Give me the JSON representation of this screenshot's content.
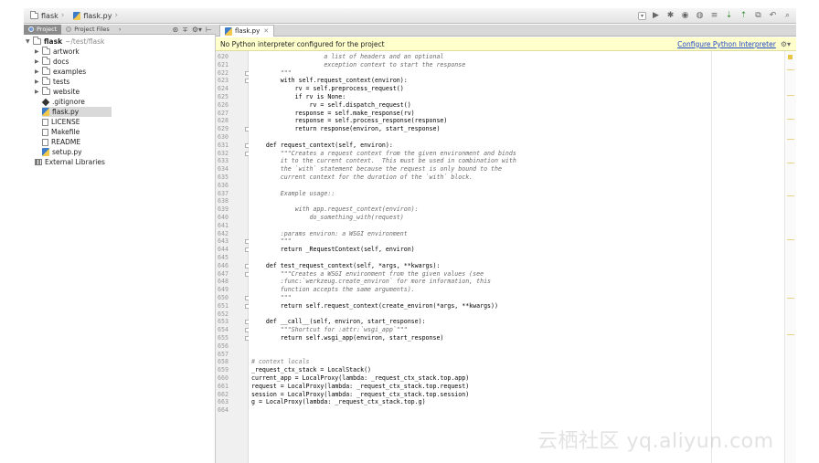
{
  "navbar": {
    "breadcrumbs": [
      {
        "label": "flask",
        "icon": "folder-icon"
      },
      {
        "label": "flask.py",
        "icon": "python-file-icon"
      }
    ],
    "tools": [
      "dropdown-icon",
      "run-icon",
      "debug-icon",
      "coverage-icon",
      "profile-icon",
      "build-icon",
      "vcs-update-icon",
      "vcs-commit-icon",
      "vcs-history-icon",
      "revert-icon",
      "search-icon"
    ]
  },
  "project_panel": {
    "tabs": [
      {
        "label": "Project",
        "active": true
      },
      {
        "label": "Project Files",
        "active": false
      }
    ],
    "root": {
      "label": "flask",
      "path": "~/test/flask"
    },
    "items": [
      {
        "label": "artwork",
        "type": "folder"
      },
      {
        "label": "docs",
        "type": "folder"
      },
      {
        "label": "examples",
        "type": "folder"
      },
      {
        "label": "tests",
        "type": "folder"
      },
      {
        "label": "website",
        "type": "folder"
      },
      {
        "label": ".gitignore",
        "type": "git"
      },
      {
        "label": "flask.py",
        "type": "python",
        "selected": true
      },
      {
        "label": "LICENSE",
        "type": "file"
      },
      {
        "label": "Makefile",
        "type": "file"
      },
      {
        "label": "README",
        "type": "file"
      },
      {
        "label": "setup.py",
        "type": "python"
      },
      {
        "label": "External Libraries",
        "type": "library"
      }
    ]
  },
  "editor": {
    "tab_label": "flask.py",
    "banner": {
      "message": "No Python interpreter configured for the project",
      "link": "Configure Python Interpreter"
    },
    "lines": [
      {
        "n": "620",
        "t": "                    a list of headers and an optional",
        "k": "doc"
      },
      {
        "n": "621",
        "t": "                    exception context to start the response",
        "k": "doc"
      },
      {
        "n": "622",
        "t": "        \"\"\"",
        "k": "doc"
      },
      {
        "n": "623",
        "t": "        with self.request_context(environ):",
        "k": ""
      },
      {
        "n": "624",
        "t": "            rv = self.preprocess_request()",
        "k": ""
      },
      {
        "n": "625",
        "t": "            if rv is None:",
        "k": ""
      },
      {
        "n": "626",
        "t": "                rv = self.dispatch_request()",
        "k": ""
      },
      {
        "n": "627",
        "t": "            response = self.make_response(rv)",
        "k": ""
      },
      {
        "n": "628",
        "t": "            response = self.process_response(response)",
        "k": ""
      },
      {
        "n": "629",
        "t": "            return response(environ, start_response)",
        "k": ""
      },
      {
        "n": "630",
        "t": "",
        "k": ""
      },
      {
        "n": "631",
        "t": "    def request_context(self, environ):",
        "k": ""
      },
      {
        "n": "632",
        "t": "        \"\"\"Creates a request context from the given environment and binds",
        "k": "doc"
      },
      {
        "n": "633",
        "t": "        it to the current context.  This must be used in combination with",
        "k": "doc"
      },
      {
        "n": "634",
        "t": "        the `with` statement because the request is only bound to the",
        "k": "doc"
      },
      {
        "n": "635",
        "t": "        current context for the duration of the `with` block.",
        "k": "doc"
      },
      {
        "n": "636",
        "t": "",
        "k": ""
      },
      {
        "n": "637",
        "t": "        Example usage::",
        "k": "doc"
      },
      {
        "n": "638",
        "t": "",
        "k": ""
      },
      {
        "n": "639",
        "t": "            with app.request_context(environ):",
        "k": "doc"
      },
      {
        "n": "640",
        "t": "                do_something_with(request)",
        "k": "doc"
      },
      {
        "n": "641",
        "t": "",
        "k": ""
      },
      {
        "n": "642",
        "t": "        :params environ: a WSGI environment",
        "k": "doc"
      },
      {
        "n": "643",
        "t": "        \"\"\"",
        "k": "doc"
      },
      {
        "n": "644",
        "t": "        return _RequestContext(self, environ)",
        "k": ""
      },
      {
        "n": "645",
        "t": "",
        "k": ""
      },
      {
        "n": "646",
        "t": "    def test_request_context(self, *args, **kwargs):",
        "k": ""
      },
      {
        "n": "647",
        "t": "        \"\"\"Creates a WSGI environment from the given values (see",
        "k": "doc"
      },
      {
        "n": "648",
        "t": "        :func:`werkzeug.create_environ` for more information, this",
        "k": "doc"
      },
      {
        "n": "649",
        "t": "        function accepts the same arguments).",
        "k": "doc"
      },
      {
        "n": "650",
        "t": "        \"\"\"",
        "k": "doc"
      },
      {
        "n": "651",
        "t": "        return self.request_context(create_environ(*args, **kwargs))",
        "k": ""
      },
      {
        "n": "652",
        "t": "",
        "k": ""
      },
      {
        "n": "653",
        "t": "    def __call__(self, environ, start_response):",
        "k": ""
      },
      {
        "n": "654",
        "t": "        \"\"\"Shortcut for :attr:`wsgi_app`\"\"\"",
        "k": "doc"
      },
      {
        "n": "655",
        "t": "        return self.wsgi_app(environ, start_response)",
        "k": ""
      },
      {
        "n": "656",
        "t": "",
        "k": ""
      },
      {
        "n": "657",
        "t": "",
        "k": ""
      },
      {
        "n": "658",
        "t": "# context locals",
        "k": "cmt"
      },
      {
        "n": "659",
        "t": "_request_ctx_stack = LocalStack()",
        "k": ""
      },
      {
        "n": "660",
        "t": "current_app = LocalProxy(lambda: _request_ctx_stack.top.app)",
        "k": ""
      },
      {
        "n": "661",
        "t": "request = LocalProxy(lambda: _request_ctx_stack.top.request)",
        "k": ""
      },
      {
        "n": "662",
        "t": "session = LocalProxy(lambda: _request_ctx_stack.top.session)",
        "k": ""
      },
      {
        "n": "663",
        "t": "g = LocalProxy(lambda: _request_ctx_stack.top.g)",
        "k": ""
      },
      {
        "n": "664",
        "t": "",
        "k": ""
      }
    ]
  },
  "watermark": "云栖社区 yq.aliyun.com",
  "colors": {
    "banner_bg": "#ffffcc",
    "link": "#2049c7",
    "selection": "#d9d9d9",
    "keyword": "#000080",
    "docstring": "#6a6a6a"
  }
}
